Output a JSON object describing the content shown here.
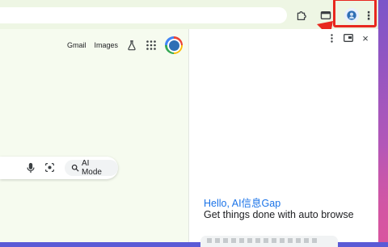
{
  "toolbar": {
    "extensions_icon": "puzzle-icon",
    "tab_search_icon": "tab-icon",
    "profile_icon": "gemini-profile-icon",
    "menu_icon": "kebab-menu-icon",
    "menu_glyph": "⋮"
  },
  "google_page": {
    "gmail_label": "Gmail",
    "images_label": "Images",
    "labs_icon": "flask-icon",
    "apps_icon": "apps-grid-icon",
    "search": {
      "mic_icon": "microphone-icon",
      "lens_icon": "camera-lens-icon",
      "ai_mode_label": "AI Mode"
    }
  },
  "side_panel": {
    "greeting": "Hello, AI信息Gap",
    "subtitle": "Get things done with auto browse",
    "close_glyph": "×"
  },
  "annotation": {
    "highlight_color": "#e8281f"
  }
}
